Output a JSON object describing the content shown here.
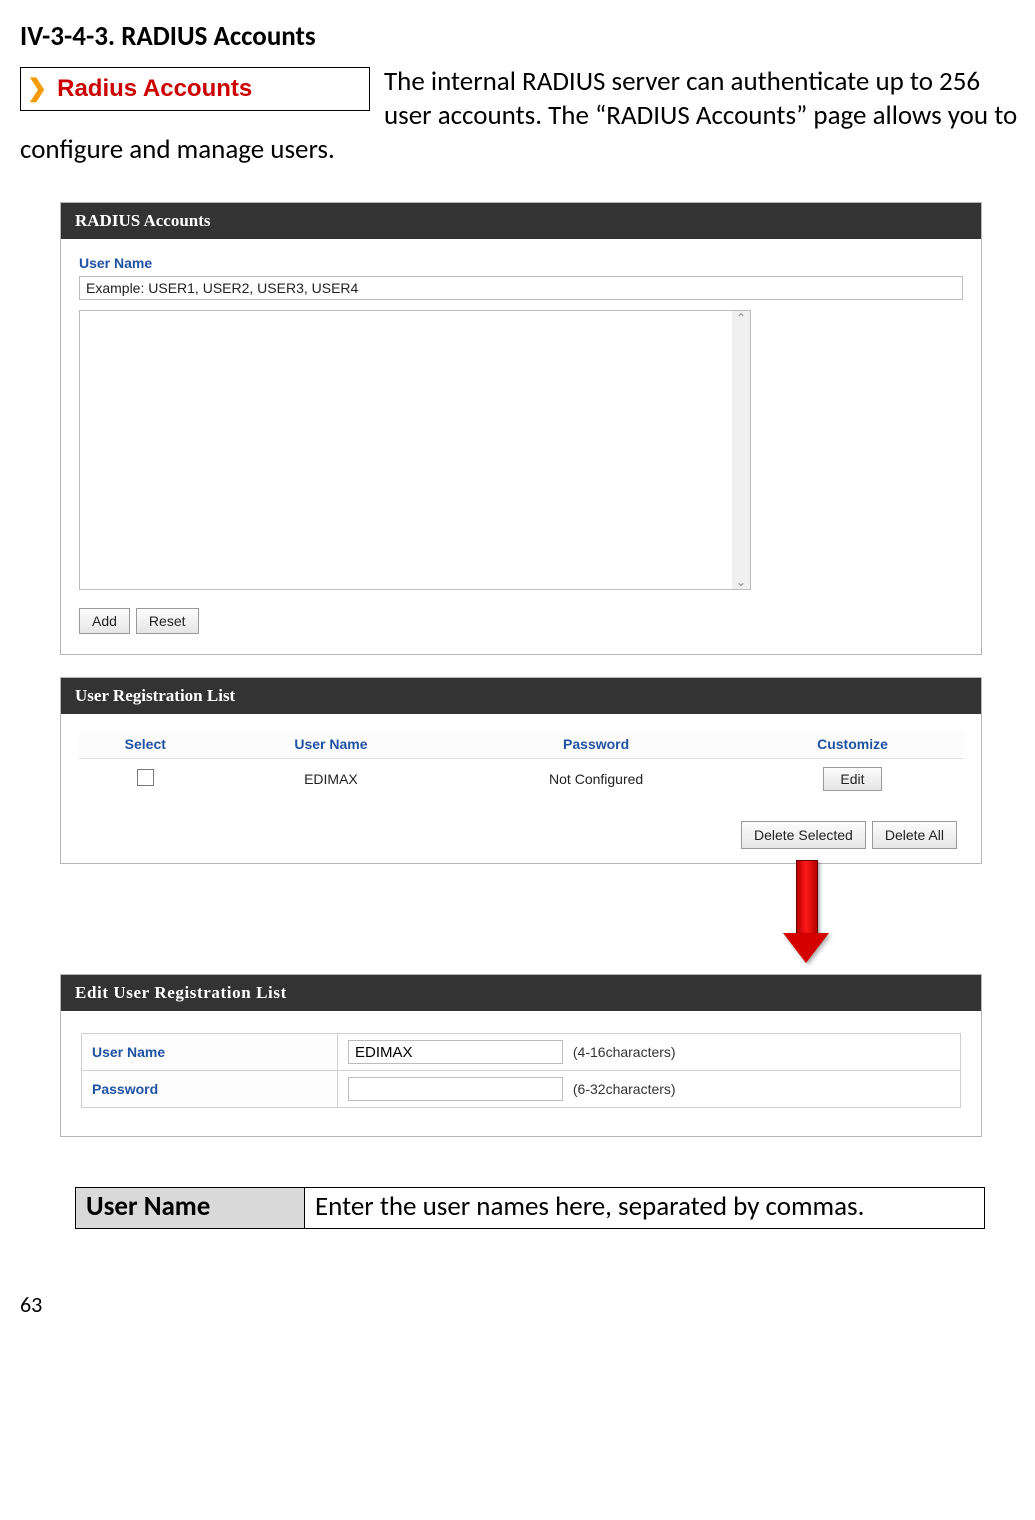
{
  "section": {
    "heading": "IV-3-4-3.   RADIUS Accounts",
    "badge_label": "Radius Accounts",
    "intro_text": "The internal RADIUS server can authenticate up to 256 user accounts. The “RADIUS Accounts” page allows you to configure and manage users."
  },
  "panel_accounts": {
    "title": "RADIUS Accounts",
    "field_label": "User Name",
    "example_value": "Example: USER1, USER2, USER3, USER4",
    "buttons": {
      "add": "Add",
      "reset": "Reset"
    }
  },
  "panel_list": {
    "title": "User Registration List",
    "columns": {
      "select": "Select",
      "username": "User Name",
      "password": "Password",
      "customize": "Customize"
    },
    "row": {
      "username": "EDIMAX",
      "password": "Not Configured",
      "edit": "Edit"
    },
    "buttons": {
      "delete_selected": "Delete Selected",
      "delete_all": "Delete All"
    }
  },
  "panel_edit": {
    "title": "Edit User Registration List",
    "rows": {
      "username": {
        "label": "User Name",
        "value": "EDIMAX",
        "hint": "(4-16characters)"
      },
      "password": {
        "label": "Password",
        "value": "",
        "hint": "(6-32characters)"
      }
    }
  },
  "description_table": {
    "key": "User Name",
    "value": "Enter the user names here, separated by commas."
  },
  "page_number": "63"
}
